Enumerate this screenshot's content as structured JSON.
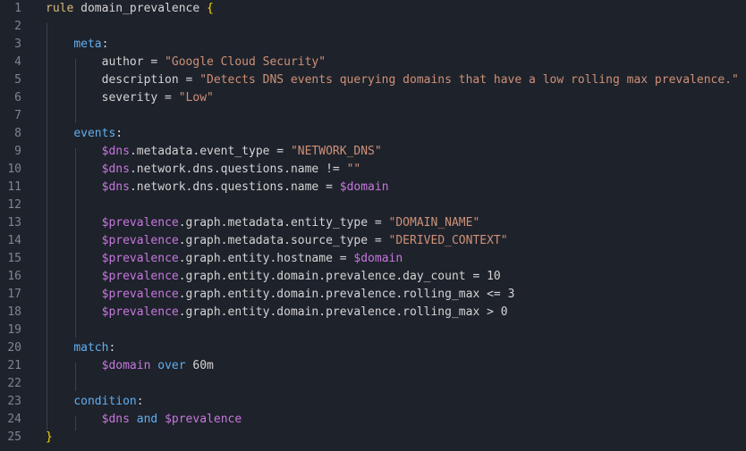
{
  "editor": {
    "lines": [
      {
        "n": "1",
        "segs": [
          [
            "kwrule",
            "rule"
          ],
          [
            "plain",
            " domain_prevalence "
          ],
          [
            "brace",
            "{"
          ]
        ]
      },
      {
        "n": "2",
        "segs": []
      },
      {
        "n": "3",
        "segs": [
          [
            "plain",
            "    "
          ],
          [
            "sec",
            "meta"
          ],
          [
            "plain",
            ":"
          ]
        ]
      },
      {
        "n": "4",
        "segs": [
          [
            "plain",
            "        author = "
          ],
          [
            "str",
            "\"Google Cloud Security\""
          ]
        ]
      },
      {
        "n": "5",
        "segs": [
          [
            "plain",
            "        description = "
          ],
          [
            "str",
            "\"Detects DNS events querying domains that have a low rolling max prevalence.\""
          ]
        ]
      },
      {
        "n": "6",
        "segs": [
          [
            "plain",
            "        severity = "
          ],
          [
            "str",
            "\"Low\""
          ]
        ]
      },
      {
        "n": "7",
        "segs": []
      },
      {
        "n": "8",
        "segs": [
          [
            "plain",
            "    "
          ],
          [
            "sec",
            "events"
          ],
          [
            "plain",
            ":"
          ]
        ]
      },
      {
        "n": "9",
        "segs": [
          [
            "plain",
            "        "
          ],
          [
            "var",
            "$dns"
          ],
          [
            "plain",
            ".metadata.event_type = "
          ],
          [
            "str",
            "\"NETWORK_DNS\""
          ]
        ]
      },
      {
        "n": "10",
        "segs": [
          [
            "plain",
            "        "
          ],
          [
            "var",
            "$dns"
          ],
          [
            "plain",
            ".network.dns.questions.name != "
          ],
          [
            "str",
            "\"\""
          ]
        ]
      },
      {
        "n": "11",
        "segs": [
          [
            "plain",
            "        "
          ],
          [
            "var",
            "$dns"
          ],
          [
            "plain",
            ".network.dns.questions.name = "
          ],
          [
            "var",
            "$domain"
          ]
        ]
      },
      {
        "n": "12",
        "segs": []
      },
      {
        "n": "13",
        "segs": [
          [
            "plain",
            "        "
          ],
          [
            "var",
            "$prevalence"
          ],
          [
            "plain",
            ".graph.metadata.entity_type = "
          ],
          [
            "str",
            "\"DOMAIN_NAME\""
          ]
        ]
      },
      {
        "n": "14",
        "segs": [
          [
            "plain",
            "        "
          ],
          [
            "var",
            "$prevalence"
          ],
          [
            "plain",
            ".graph.metadata.source_type = "
          ],
          [
            "str",
            "\"DERIVED_CONTEXT\""
          ]
        ]
      },
      {
        "n": "15",
        "segs": [
          [
            "plain",
            "        "
          ],
          [
            "var",
            "$prevalence"
          ],
          [
            "plain",
            ".graph.entity.hostname = "
          ],
          [
            "var",
            "$domain"
          ]
        ]
      },
      {
        "n": "16",
        "segs": [
          [
            "plain",
            "        "
          ],
          [
            "var",
            "$prevalence"
          ],
          [
            "plain",
            ".graph.entity.domain.prevalence.day_count = 10"
          ]
        ]
      },
      {
        "n": "17",
        "segs": [
          [
            "plain",
            "        "
          ],
          [
            "var",
            "$prevalence"
          ],
          [
            "plain",
            ".graph.entity.domain.prevalence.rolling_max <= 3"
          ]
        ]
      },
      {
        "n": "18",
        "segs": [
          [
            "plain",
            "        "
          ],
          [
            "var",
            "$prevalence"
          ],
          [
            "plain",
            ".graph.entity.domain.prevalence.rolling_max > 0"
          ]
        ]
      },
      {
        "n": "19",
        "segs": []
      },
      {
        "n": "20",
        "segs": [
          [
            "plain",
            "    "
          ],
          [
            "sec",
            "match"
          ],
          [
            "plain",
            ":"
          ]
        ]
      },
      {
        "n": "21",
        "segs": [
          [
            "plain",
            "        "
          ],
          [
            "var",
            "$domain"
          ],
          [
            "plain",
            " "
          ],
          [
            "sec",
            "over"
          ],
          [
            "plain",
            " 60m"
          ]
        ]
      },
      {
        "n": "22",
        "segs": []
      },
      {
        "n": "23",
        "segs": [
          [
            "plain",
            "    "
          ],
          [
            "sec",
            "condition"
          ],
          [
            "plain",
            ":"
          ]
        ]
      },
      {
        "n": "24",
        "segs": [
          [
            "plain",
            "        "
          ],
          [
            "var",
            "$dns"
          ],
          [
            "plain",
            " "
          ],
          [
            "sec",
            "and"
          ],
          [
            "plain",
            " "
          ],
          [
            "var",
            "$prevalence"
          ]
        ]
      },
      {
        "n": "25",
        "segs": [
          [
            "brace",
            "}"
          ]
        ]
      }
    ]
  },
  "colors": {
    "background": "#1e222b",
    "line_number": "#7d8590",
    "rule_keyword": "#d7ba7d",
    "section_keyword": "#61afef",
    "string": "#ce9178",
    "variable": "#c678dd",
    "brace": "#ffd700"
  }
}
